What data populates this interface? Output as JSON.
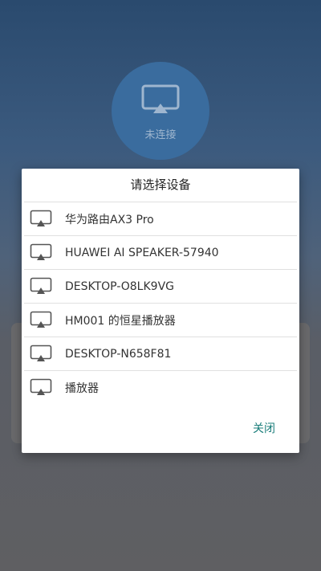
{
  "cast_status": {
    "icon": "screen-cast-icon",
    "label": "未连接"
  },
  "dialog": {
    "title": "请选择设备",
    "close_label": "关闭",
    "accent_color": "#1a7d7a",
    "devices": [
      {
        "name": "华为路由AX3 Pro",
        "icon": "screen-cast-icon"
      },
      {
        "name": "HUAWEI AI SPEAKER-57940",
        "icon": "screen-cast-icon"
      },
      {
        "name": "DESKTOP-O8LK9VG",
        "icon": "screen-cast-icon"
      },
      {
        "name": "HM001 的恒星播放器",
        "icon": "screen-cast-icon"
      },
      {
        "name": "DESKTOP-N658F81",
        "icon": "screen-cast-icon"
      },
      {
        "name": "播放器",
        "icon": "screen-cast-icon"
      }
    ]
  }
}
